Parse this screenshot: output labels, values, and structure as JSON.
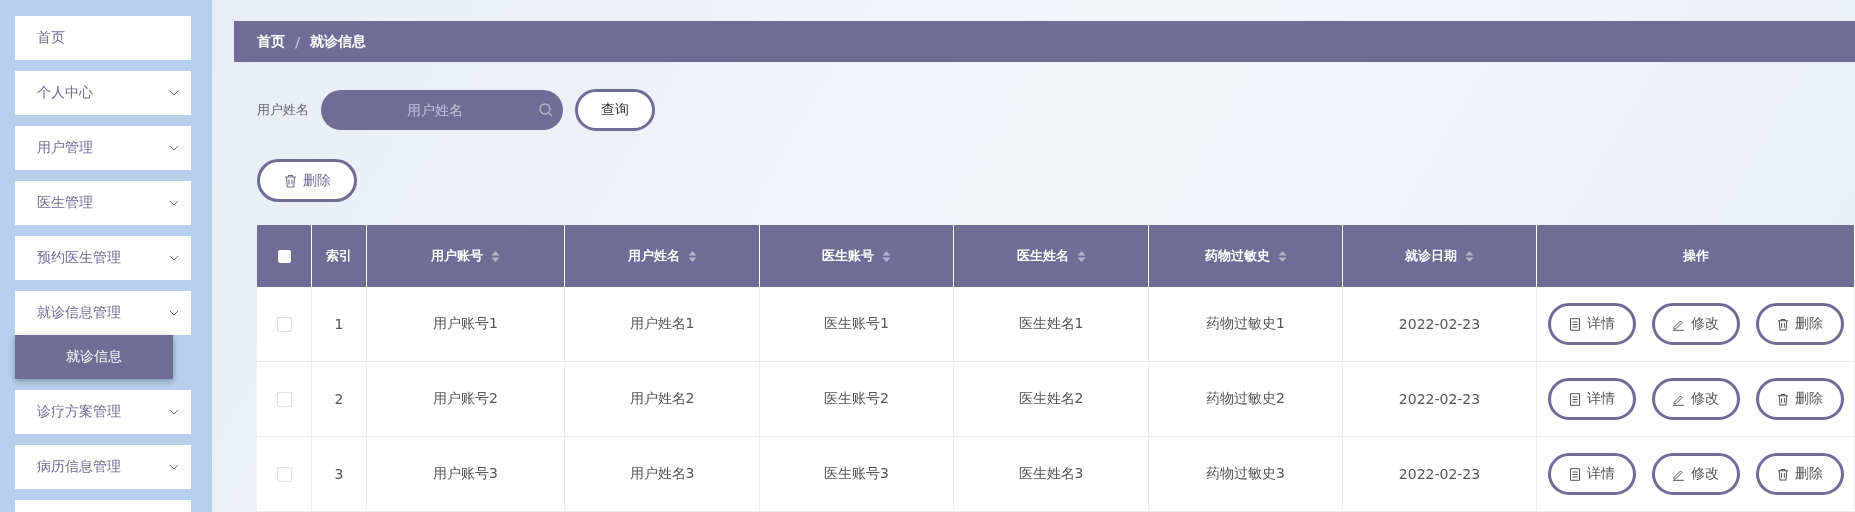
{
  "sidebar": {
    "items": [
      {
        "label": "首页",
        "kind": "link"
      },
      {
        "label": "个人中心",
        "kind": "submenu"
      },
      {
        "label": "用户管理",
        "kind": "submenu"
      },
      {
        "label": "医生管理",
        "kind": "submenu"
      },
      {
        "label": "预约医生管理",
        "kind": "submenu"
      },
      {
        "label": "就诊信息管理",
        "kind": "submenu",
        "children": [
          {
            "label": "就诊信息",
            "selected": true
          }
        ]
      },
      {
        "label": "诊疗方案管理",
        "kind": "submenu"
      },
      {
        "label": "病历信息管理",
        "kind": "submenu"
      }
    ]
  },
  "breadcrumb": [
    "首页",
    "/",
    "就诊信息"
  ],
  "search": {
    "label": "用户姓名",
    "placeholder": "用户姓名",
    "button": "查询"
  },
  "delete_button": "删除",
  "table": {
    "select_all_checked": false,
    "columns": [
      {
        "label": "索引",
        "sortable": false
      },
      {
        "label": "用户账号",
        "sortable": true
      },
      {
        "label": "用户姓名",
        "sortable": true
      },
      {
        "label": "医生账号",
        "sortable": true
      },
      {
        "label": "医生姓名",
        "sortable": true
      },
      {
        "label": "药物过敏史",
        "sortable": true
      },
      {
        "label": "就诊日期",
        "sortable": true
      },
      {
        "label": "操作",
        "sortable": false
      }
    ],
    "rows": [
      {
        "checked": false,
        "cells": [
          "1",
          "用户账号1",
          "用户姓名1",
          "医生账号1",
          "医生姓名1",
          "药物过敏史1",
          "2022-02-23"
        ],
        "actions": [
          "详情",
          "修改",
          "删除"
        ]
      },
      {
        "checked": false,
        "cells": [
          "2",
          "用户账号2",
          "用户姓名2",
          "医生账号2",
          "医生姓名2",
          "药物过敏史2",
          "2022-02-23"
        ],
        "actions": [
          "详情",
          "修改",
          "删除"
        ]
      },
      {
        "checked": false,
        "cells": [
          "3",
          "用户账号3",
          "用户姓名3",
          "医生账号3",
          "医生姓名3",
          "药物过敏史3",
          "2022-02-23"
        ],
        "actions": [
          "详情",
          "修改",
          "删除"
        ]
      }
    ]
  }
}
